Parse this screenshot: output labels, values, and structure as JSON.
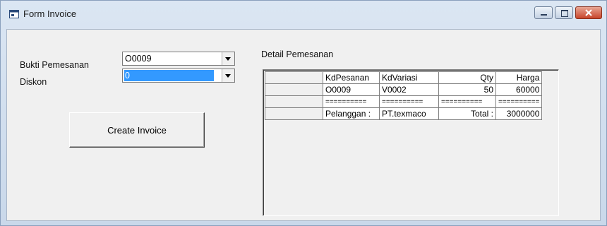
{
  "window": {
    "title": "Form Invoice",
    "icon": "form-window-icon"
  },
  "form": {
    "bukti_label": "Bukti Pemesanan",
    "bukti_value": "O0009",
    "diskon_label": "Diskon",
    "diskon_value": "0",
    "create_button": "Create Invoice"
  },
  "detail": {
    "title": "Detail Pemesanan",
    "headers": [
      "KdPesanan",
      "KdVariasi",
      "Qty",
      "Harga"
    ],
    "row1": [
      "O0009",
      "V0002",
      "50",
      "60000"
    ],
    "separator": [
      "==========",
      "==========",
      "==========",
      "=========="
    ],
    "total_row": [
      "Pelanggan :",
      "PT.texmaco",
      "Total :",
      "3000000"
    ]
  }
}
